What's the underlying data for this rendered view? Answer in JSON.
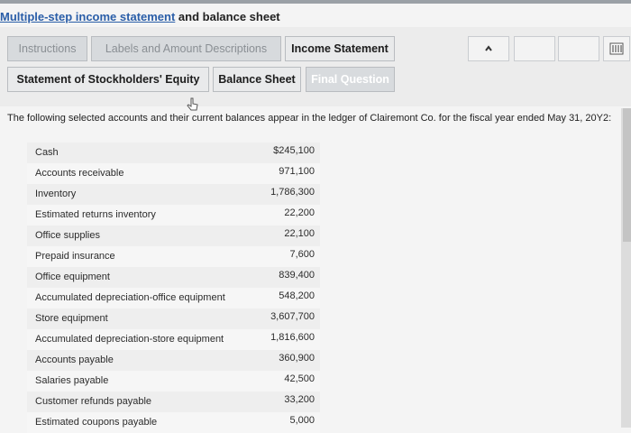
{
  "title": {
    "underlined": "Multiple-step income statement",
    "rest": " and balance sheet"
  },
  "tabs": [
    {
      "label": "Instructions"
    },
    {
      "label": "Labels and Amount Descriptions"
    },
    {
      "label": "Income Statement"
    },
    {
      "label": "Statement of Stockholders' Equity"
    },
    {
      "label": "Balance Sheet"
    },
    {
      "label": "Final Question"
    }
  ],
  "nav": {
    "prev_icon": "chevron-left-icon",
    "calculator_icon": "calculator-icon"
  },
  "intro": "The following selected accounts and their current balances appear in the ledger of Clairemont Co. for the fiscal year ended May 31, 20Y2:",
  "accounts": [
    {
      "name": "Cash",
      "amount": "$245,100"
    },
    {
      "name": "Accounts receivable",
      "amount": "971,100"
    },
    {
      "name": "Inventory",
      "amount": "1,786,300"
    },
    {
      "name": "Estimated returns inventory",
      "amount": "22,200"
    },
    {
      "name": "Office supplies",
      "amount": "22,100"
    },
    {
      "name": "Prepaid insurance",
      "amount": "7,600"
    },
    {
      "name": "Office equipment",
      "amount": "839,400"
    },
    {
      "name": "Accumulated depreciation-office equipment",
      "amount": "548,200"
    },
    {
      "name": "Store equipment",
      "amount": "3,607,700"
    },
    {
      "name": "Accumulated depreciation-store equipment",
      "amount": "1,816,600"
    },
    {
      "name": "Accounts payable",
      "amount": "360,900"
    },
    {
      "name": "Salaries payable",
      "amount": "42,500"
    },
    {
      "name": "Customer refunds payable",
      "amount": "33,200"
    },
    {
      "name": "Estimated coupons payable",
      "amount": "5,000"
    }
  ],
  "colors": {
    "link": "#2a5ea8",
    "panel": "#ececec",
    "tab_border": "#b9bcc0"
  }
}
